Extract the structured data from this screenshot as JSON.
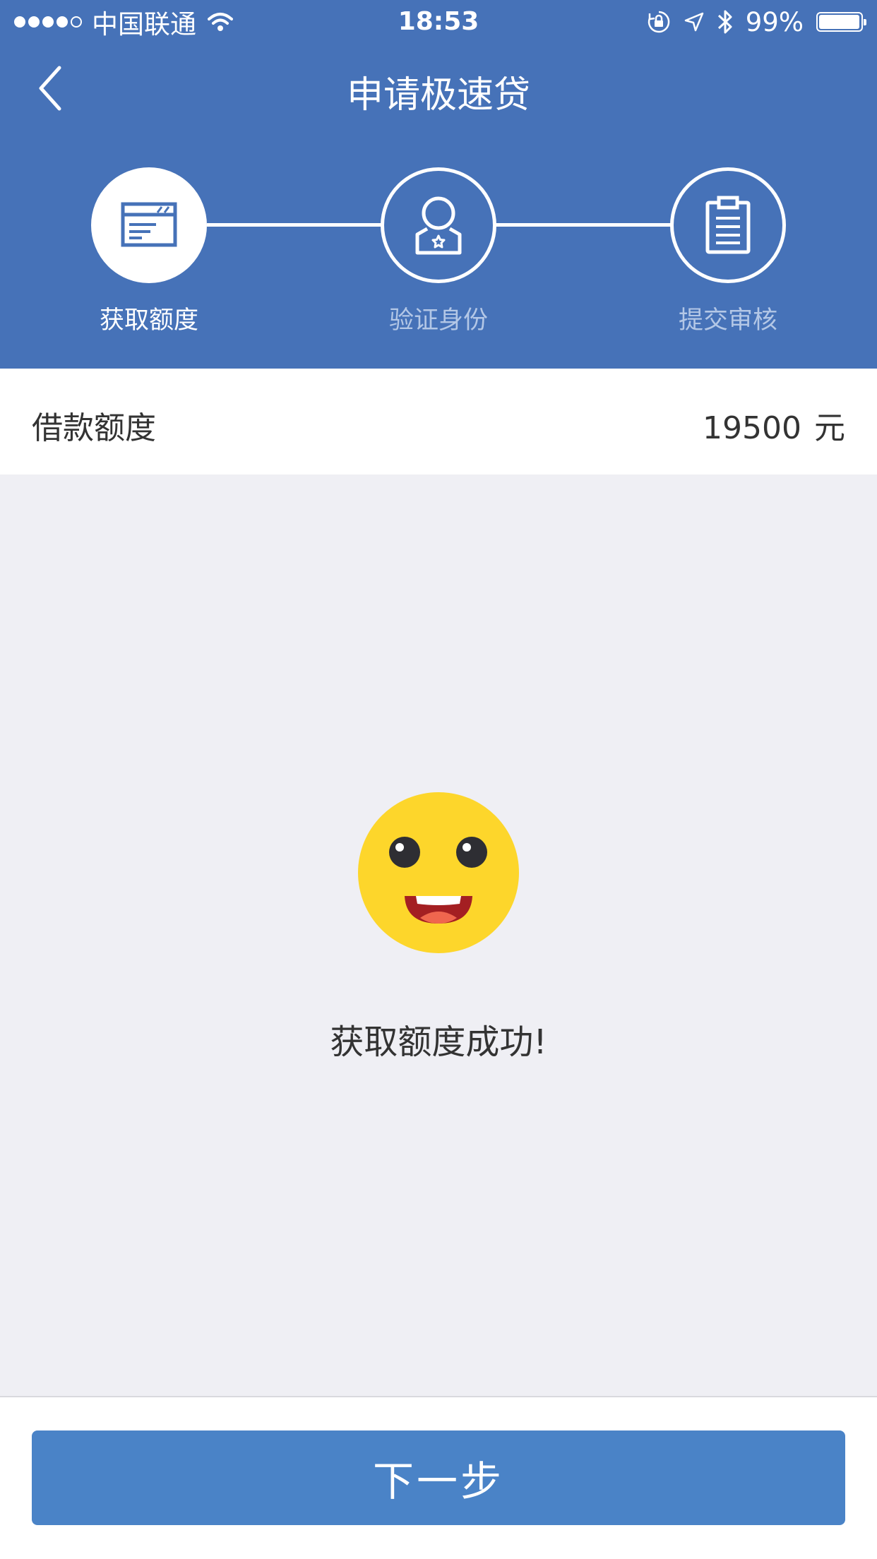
{
  "status_bar": {
    "carrier": "中国联通",
    "time": "18:53",
    "battery": "99%",
    "battery_level": 0.99,
    "signal_bars_filled": 4,
    "signal_bars_total": 5,
    "icons": [
      "wifi-icon",
      "rotation-lock-icon",
      "location-icon",
      "bluetooth-icon",
      "battery-icon"
    ]
  },
  "nav": {
    "title": "申请极速贷",
    "back_icon": "chevron-left-icon"
  },
  "steps": [
    {
      "label": "获取额度",
      "icon": "card-icon",
      "active": true
    },
    {
      "label": "验证身份",
      "icon": "user-badge-icon",
      "active": false
    },
    {
      "label": "提交审核",
      "icon": "clipboard-icon",
      "active": false
    }
  ],
  "amount": {
    "label": "借款额度",
    "value": "19500",
    "unit": "元"
  },
  "result": {
    "icon": "smiley-face-icon",
    "message": "获取额度成功!"
  },
  "footer": {
    "next_label": "下一步"
  },
  "colors": {
    "header_bg": "#4672b8",
    "button_bg": "#4a83c7",
    "page_bg": "#efeff4",
    "active_step_icon": "#4672b8",
    "inactive_step_label": "#b3c7e6",
    "smiley_yellow": "#fdd62b"
  }
}
